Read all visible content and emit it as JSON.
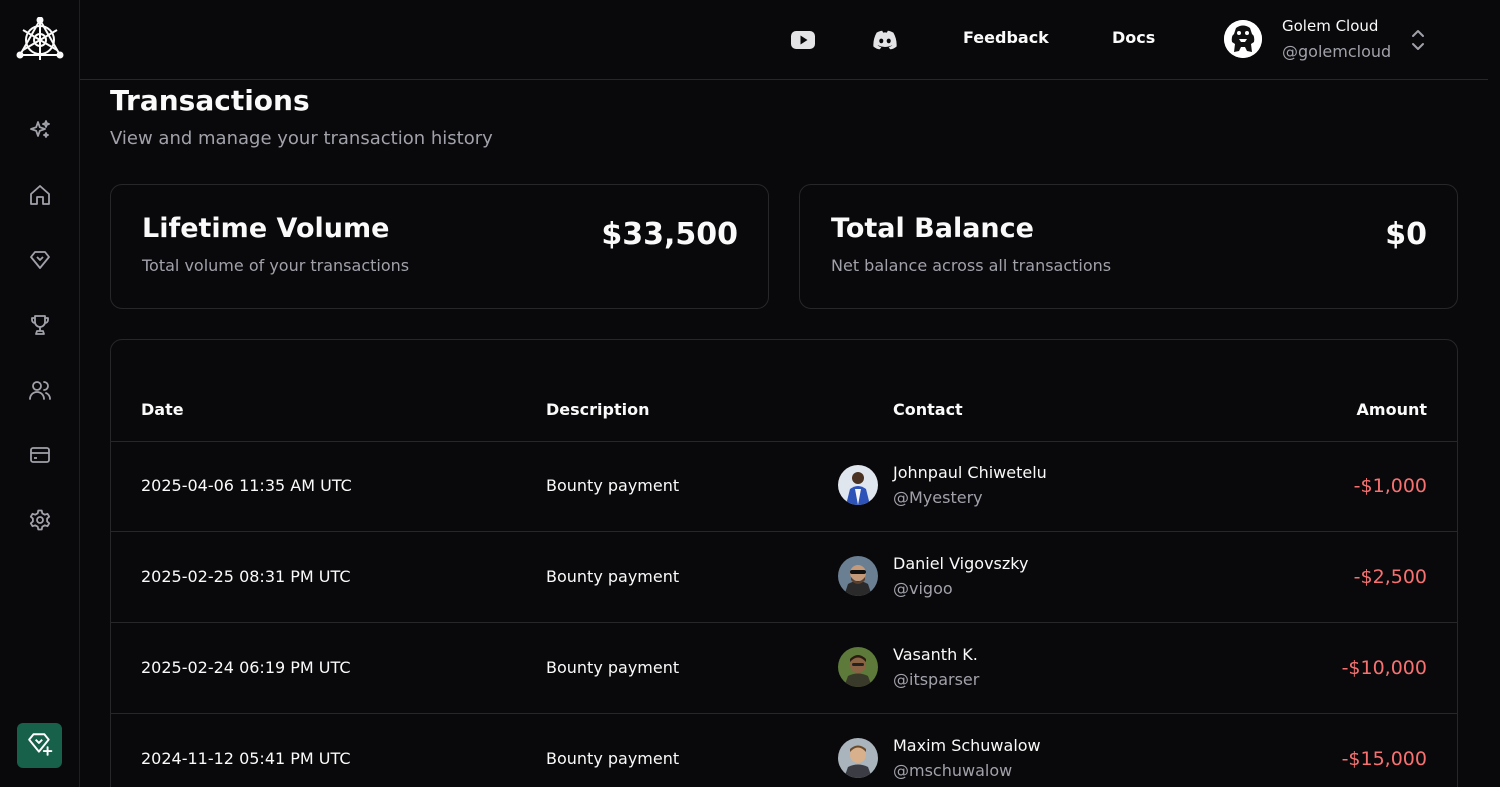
{
  "topbar": {
    "feedback_label": "Feedback",
    "docs_label": "Docs",
    "profile": {
      "name": "Golem Cloud",
      "handle": "@golemcloud"
    }
  },
  "page": {
    "title": "Transactions",
    "subtitle": "View and manage your transaction history"
  },
  "stats": [
    {
      "title": "Lifetime Volume",
      "description": "Total volume of your transactions",
      "value": "$33,500"
    },
    {
      "title": "Total Balance",
      "description": "Net balance across all transactions",
      "value": "$0"
    }
  ],
  "table": {
    "columns": [
      "Date",
      "Description",
      "Contact",
      "Amount"
    ],
    "rows": [
      {
        "date": "2025-04-06 11:35 AM UTC",
        "description": "Bounty payment",
        "name": "Johnpaul Chiwetelu",
        "handle": "@Myestery",
        "amount": "-$1,000"
      },
      {
        "date": "2025-02-25 08:31 PM UTC",
        "description": "Bounty payment",
        "name": "Daniel Vigovszky",
        "handle": "@vigoo",
        "amount": "-$2,500"
      },
      {
        "date": "2025-02-24 06:19 PM UTC",
        "description": "Bounty payment",
        "name": "Vasanth K.",
        "handle": "@itsparser",
        "amount": "-$10,000"
      },
      {
        "date": "2024-11-12 05:41 PM UTC",
        "description": "Bounty payment",
        "name": "Maxim Schuwalow",
        "handle": "@mschuwalow",
        "amount": "-$15,000"
      }
    ]
  },
  "colors": {
    "background": "#09090b",
    "border": "#27272a",
    "muted_text": "#a1a1aa",
    "negative_amount": "#f87171",
    "bounty_button": "#17604a"
  },
  "icons": {
    "sidebar": [
      "sparkles-icon",
      "home-icon",
      "diamond-icon",
      "trophy-icon",
      "users-icon",
      "credit-card-icon",
      "settings-icon"
    ],
    "topbar": [
      "youtube-icon",
      "discord-icon",
      "chevron-up-down-icon"
    ],
    "bottom": "diamond-plus-icon"
  }
}
